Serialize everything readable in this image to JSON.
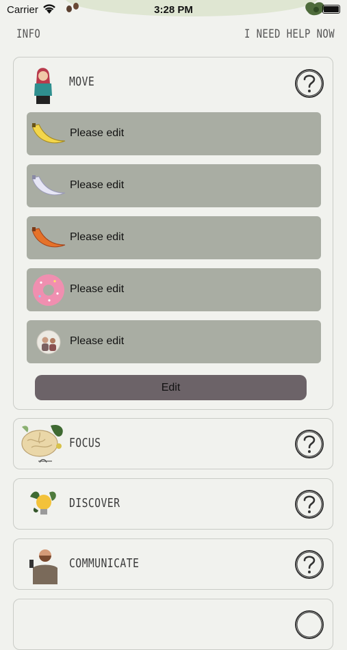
{
  "status_bar": {
    "carrier": "Carrier",
    "time": "3:28 PM"
  },
  "nav": {
    "info": "INFO",
    "help_now": "I NEED HELP NOW"
  },
  "sections": [
    {
      "title": "MOVE",
      "expanded": true,
      "items": [
        {
          "label": "Please edit",
          "icon": "yellow-banana-icon"
        },
        {
          "label": "Please edit",
          "icon": "white-banana-icon"
        },
        {
          "label": "Please edit",
          "icon": "orange-banana-icon"
        },
        {
          "label": "Please edit",
          "icon": "donut-icon"
        },
        {
          "label": "Please edit",
          "icon": "people-photo-icon"
        }
      ],
      "edit_label": "Edit"
    },
    {
      "title": "FOCUS"
    },
    {
      "title": "DISCOVER"
    },
    {
      "title": "COMMUNICATE"
    }
  ],
  "colors": {
    "background": "#f1f2ee",
    "item_bg": "#a9ada3",
    "edit_button": "#6c6368"
  }
}
